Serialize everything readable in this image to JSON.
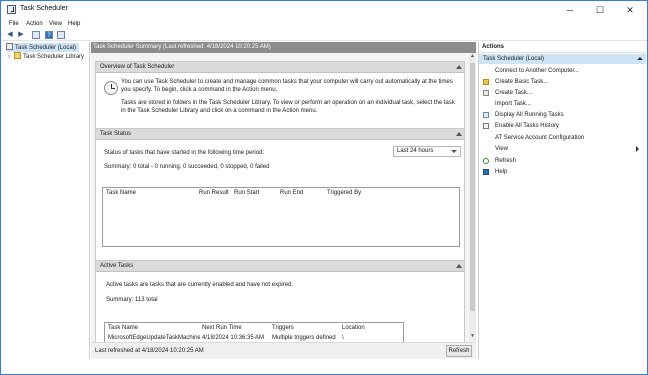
{
  "window": {
    "title": "Task Scheduler",
    "controls": {
      "minimize": "─",
      "maximize": "☐",
      "close": "✕"
    }
  },
  "menu": [
    "File",
    "Action",
    "View",
    "Help"
  ],
  "toolbar": {
    "icons": [
      "back-arrow-icon",
      "forward-arrow-icon",
      "panel-icon",
      "help-icon",
      "panel-alt-icon"
    ],
    "back_glyph": "◀",
    "forward_glyph": "▶",
    "help_glyph": "?"
  },
  "tree": {
    "root": "Task Scheduler (Local)",
    "child": "Task Scheduler Library",
    "expander": "›"
  },
  "summary": {
    "header": "Task Scheduler Summary (Last refreshed: 4/18/2024 10:20:25 AM)",
    "overview": {
      "title": "Overview of Task Scheduler",
      "para1": "You can use Task Scheduler to create and manage common tasks that your computer will carry out automatically at the times you specify. To begin, click a command in the Action menu.",
      "para2": "Tasks are stored in folders in the Task Scheduler Library. To view or perform an operation on an individual task, select the task in the Task Scheduler Library and click on a command in the Action menu."
    },
    "status": {
      "title": "Task Status",
      "period_label": "Status of tasks that have started in the following time period:",
      "period_value": "Last 24 hours",
      "summary": "Summary: 0 total - 0 running, 0 succeeded, 0 stopped, 0 failed",
      "columns": [
        "Task Name",
        "Run Result",
        "Run Start",
        "Run End",
        "Triggered By"
      ]
    },
    "active": {
      "title": "Active Tasks",
      "desc": "Active tasks are tasks that are currently enabled and have not expired.",
      "summary": "Summary: 113 total",
      "columns": [
        "Task Name",
        "Next Run Time",
        "Triggers",
        "Location"
      ],
      "rows": [
        {
          "name": "MicrosoftEdgeUpdateTaskMachine...",
          "next": "4/18/2024 10:36:35 AM",
          "triggers": "Multiple triggers defined",
          "location": "\\"
        }
      ]
    },
    "last_refreshed": "Last refreshed at 4/18/2024 10:20:25 AM",
    "refresh_button": "Refresh"
  },
  "actions": {
    "title": "Actions",
    "subheader": "Task Scheduler (Local)",
    "items": [
      {
        "label": "Connect to Another Computer...",
        "icon": "none"
      },
      {
        "label": "Create Basic Task...",
        "icon": "create-basic-task-icon"
      },
      {
        "label": "Create Task...",
        "icon": "create-task-icon"
      },
      {
        "label": "Import Task...",
        "icon": "none"
      },
      {
        "label": "Display All Running Tasks",
        "icon": "running-tasks-icon"
      },
      {
        "label": "Enable All Tasks History",
        "icon": "history-icon"
      },
      {
        "label": "AT Service Account Configuration",
        "icon": "none"
      },
      {
        "label": "View",
        "icon": "none"
      },
      {
        "label": "Refresh",
        "icon": "refresh-icon"
      },
      {
        "label": "Help",
        "icon": "help-icon"
      }
    ]
  },
  "colors": {
    "accent": "#3a7bd5",
    "selection": "#cde4f7",
    "summary_header": "#8c8c8c",
    "section_header": "#dbdbdb"
  }
}
